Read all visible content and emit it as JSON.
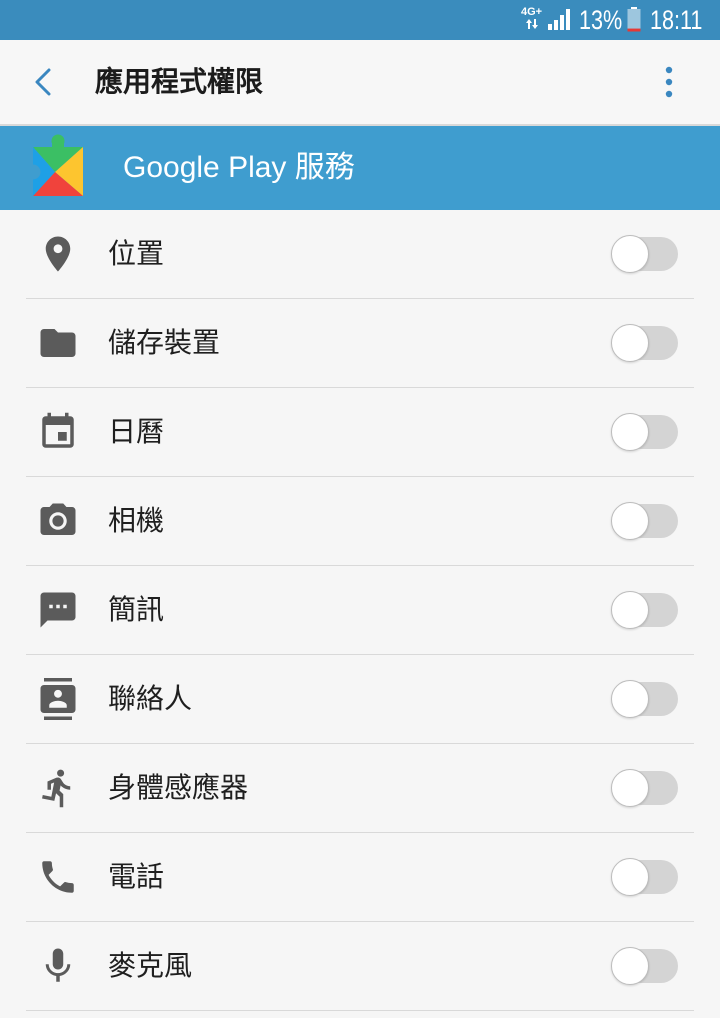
{
  "status_bar": {
    "network_type": "4G+",
    "data_icon": "data-activity-icon",
    "signal_icon": "signal-icon",
    "battery_text": "13%",
    "battery_icon": "battery-icon",
    "battery_level": 0.13,
    "time": "18:11"
  },
  "action_bar": {
    "back_icon": "back-icon",
    "title": "應用程式權限",
    "menu_icon": "more-vert-icon"
  },
  "app": {
    "icon": "google-play-services-icon",
    "name": "Google Play 服務"
  },
  "colors": {
    "status_bar": "#3a8cbd",
    "app_header": "#3f9dcf",
    "accent": "#3a87c0",
    "icon": "#5b5b5b",
    "battery_low": "#e53935"
  },
  "permissions": [
    {
      "label": "位置",
      "icon": "location-icon",
      "enabled": false
    },
    {
      "label": "儲存裝置",
      "icon": "folder-icon",
      "enabled": false
    },
    {
      "label": "日曆",
      "icon": "calendar-icon",
      "enabled": false
    },
    {
      "label": "相機",
      "icon": "camera-icon",
      "enabled": false
    },
    {
      "label": "簡訊",
      "icon": "sms-icon",
      "enabled": false
    },
    {
      "label": "聯絡人",
      "icon": "contacts-icon",
      "enabled": false
    },
    {
      "label": "身體感應器",
      "icon": "running-icon",
      "enabled": false
    },
    {
      "label": "電話",
      "icon": "phone-icon",
      "enabled": false
    },
    {
      "label": "麥克風",
      "icon": "microphone-icon",
      "enabled": false
    }
  ]
}
